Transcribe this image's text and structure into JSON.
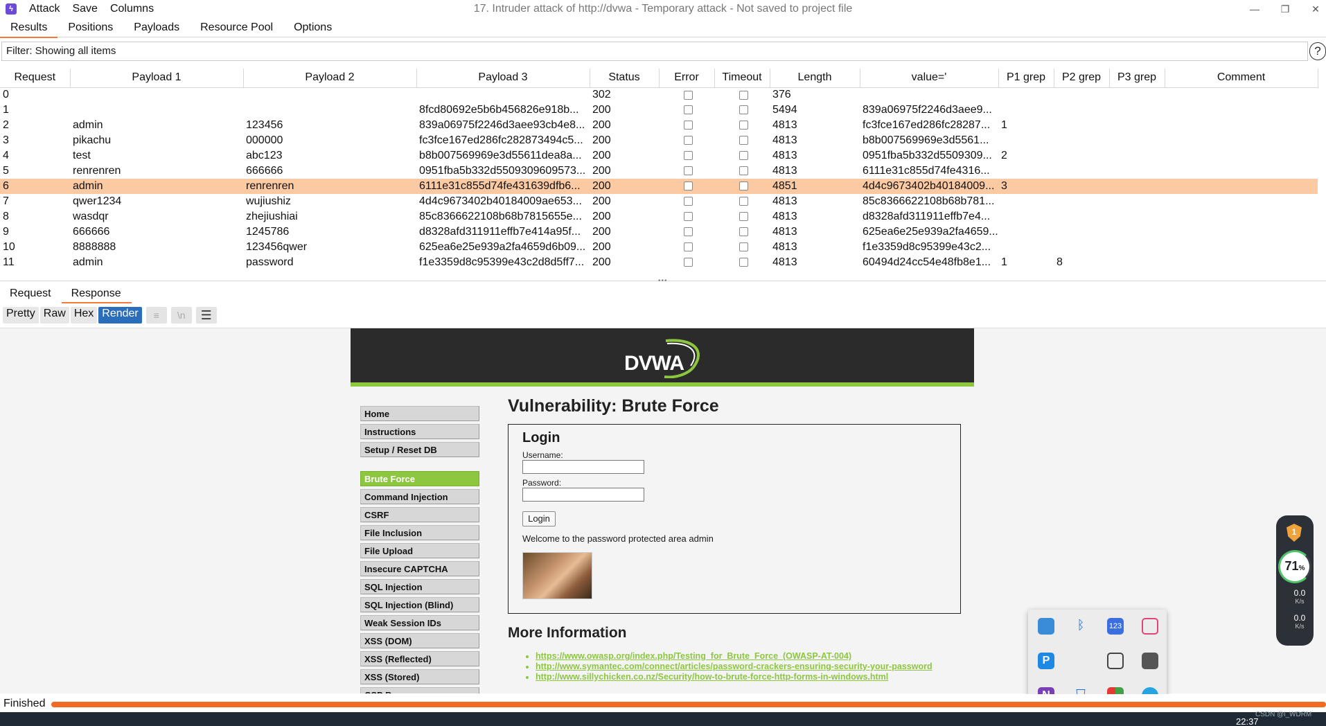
{
  "titlebar": {
    "menus": [
      "Attack",
      "Save",
      "Columns"
    ],
    "title": "17. Intruder attack of http://dvwa - Temporary attack - Not saved to project file",
    "controls": {
      "minimize": "—",
      "restore": "❐",
      "close": "✕"
    }
  },
  "tabs": [
    "Results",
    "Positions",
    "Payloads",
    "Resource Pool",
    "Options"
  ],
  "active_tab": "Results",
  "filter": {
    "text": "Filter: Showing all items",
    "help": "?"
  },
  "table": {
    "columns": [
      "Request",
      "Payload 1",
      "Payload 2",
      "Payload 3",
      "Status",
      "Error",
      "Timeout",
      "Length",
      "value='",
      "P1 grep",
      "P2 grep",
      "P3 grep",
      "Comment"
    ],
    "rows": [
      [
        "0",
        "",
        "",
        "",
        "302",
        "",
        "",
        "376",
        "",
        "",
        "",
        "",
        ""
      ],
      [
        "1",
        "",
        "",
        "8fcd80692e5b6b456826e918b...",
        "200",
        "",
        "",
        "5494",
        "839a06975f2246d3aee9...",
        "",
        "",
        "",
        ""
      ],
      [
        "2",
        "admin",
        "123456",
        "839a06975f2246d3aee93cb4e8...",
        "200",
        "",
        "",
        "4813",
        "fc3fce167ed286fc28287...",
        "1",
        "",
        "",
        ""
      ],
      [
        "3",
        "pikachu",
        "000000",
        "fc3fce167ed286fc282873494c5...",
        "200",
        "",
        "",
        "4813",
        "b8b007569969e3d5561...",
        "",
        "",
        "",
        ""
      ],
      [
        "4",
        "test",
        "abc123",
        "b8b007569969e3d55611dea8a...",
        "200",
        "",
        "",
        "4813",
        "0951fba5b332d5509309...",
        "2",
        "",
        "",
        ""
      ],
      [
        "5",
        "renrenren",
        "666666",
        "0951fba5b332d5509309609573...",
        "200",
        "",
        "",
        "4813",
        "6111e31c855d74fe4316...",
        "",
        "",
        "",
        ""
      ],
      [
        "6",
        "admin",
        "renrenren",
        "6111e31c855d74fe431639dfb6...",
        "200",
        "",
        "",
        "4851",
        "4d4c9673402b40184009...",
        "3",
        "",
        "",
        ""
      ],
      [
        "7",
        "qwer1234",
        "wujiushiz",
        "4d4c9673402b40184009ae653...",
        "200",
        "",
        "",
        "4813",
        "85c8366622108b68b781...",
        "",
        "",
        "",
        ""
      ],
      [
        "8",
        "wasdqr",
        "zhejiushiai",
        "85c8366622108b68b7815655e...",
        "200",
        "",
        "",
        "4813",
        "d8328afd311911effb7e4...",
        "",
        "",
        "",
        ""
      ],
      [
        "9",
        "666666",
        "1245786",
        "d8328afd311911effb7e414a95f...",
        "200",
        "",
        "",
        "4813",
        "625ea6e25e939a2fa4659...",
        "",
        "",
        "",
        ""
      ],
      [
        "10",
        "8888888",
        "123456qwer",
        "625ea6e25e939a2fa4659d6b09...",
        "200",
        "",
        "",
        "4813",
        "f1e3359d8c95399e43c2...",
        "",
        "",
        "",
        ""
      ],
      [
        "11",
        "admin",
        "password",
        "f1e3359d8c95399e43c2d8d5ff7...",
        "200",
        "",
        "",
        "4813",
        "60494d24cc54e48fb8e1...",
        "1",
        "8",
        "",
        ""
      ]
    ],
    "selected_row": 6
  },
  "rr_tabs": [
    "Request",
    "Response"
  ],
  "rr_active": "Response",
  "view_buttons": [
    "Pretty",
    "Raw",
    "Hex",
    "Render"
  ],
  "view_active": "Render",
  "view_icons": {
    "wrap": "≡",
    "newline": "\\n",
    "menu": "☰"
  },
  "dvwa": {
    "logo": "DVWA",
    "menu_top": [
      "Home",
      "Instructions",
      "Setup / Reset DB"
    ],
    "menu_vulns": [
      "Brute Force",
      "Command Injection",
      "CSRF",
      "File Inclusion",
      "File Upload",
      "Insecure CAPTCHA",
      "SQL Injection",
      "SQL Injection (Blind)",
      "Weak Session IDs",
      "XSS (DOM)",
      "XSS (Reflected)",
      "XSS (Stored)",
      "CSP B..."
    ],
    "active_menu": "Brute Force",
    "title": "Vulnerability: Brute Force",
    "login_title": "Login",
    "username_label": "Username:",
    "password_label": "Password:",
    "login_button": "Login",
    "welcome": "Welcome to the password protected area admin",
    "more_info_title": "More Information",
    "links": [
      "https://www.owasp.org/index.php/Testing_for_Brute_Force_(OWASP-AT-004)",
      "http://www.symantec.com/connect/articles/password-crackers-ensuring-security-your-password",
      "http://www.sillychicken.co.nz/Security/how-to-brute-force-http-forms-in-windows.html"
    ]
  },
  "widget": {
    "percent": "71",
    "percent_unit": "%",
    "up": "0.0",
    "down": "0.0",
    "unit": "K/s",
    "badge": "1"
  },
  "status": {
    "text": "Finished",
    "progress": 1.0
  },
  "clock": "22:37",
  "watermark": "CSDN @i_WDRM",
  "colors": {
    "accent": "#f47a3c",
    "selected_row": "#fbc9a2",
    "render_active": "#2a6ebb",
    "dvwa_green": "#8dc63f",
    "progress": "#f26b25"
  }
}
